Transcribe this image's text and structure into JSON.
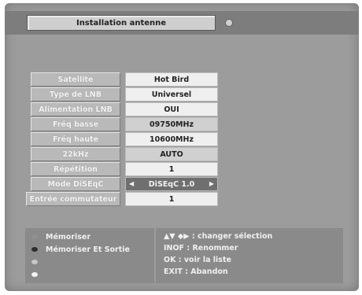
{
  "header": {
    "title": "Installation antenne"
  },
  "rows": [
    {
      "label": "Satellite",
      "value": "Hot Bird"
    },
    {
      "label": "Type de LNB",
      "value": "Universel"
    },
    {
      "label": "Alimentation LNB",
      "value": "OUI"
    },
    {
      "label": "Fréq basse",
      "value": "09750MHz"
    },
    {
      "label": "Fréq haute",
      "value": "10600MHz"
    },
    {
      "label": "22kHz",
      "value": "AUTO"
    },
    {
      "label": "Répétition",
      "value": "1"
    },
    {
      "label": "Mode DiSEqC",
      "value": "DiSEqC 1.0"
    },
    {
      "label": "Entrée commutateur",
      "value": "1"
    }
  ],
  "legend": {
    "actions": [
      {
        "label": "Mémoriser",
        "color": "#8f8f8f"
      },
      {
        "label": "Mémoriser  Et Sortie",
        "color": "#2d2d2d"
      },
      {
        "label": "",
        "color": "#c8c8c8"
      },
      {
        "label": "",
        "color": "#f4f4f4"
      }
    ],
    "help": [
      "▲▼ ◆▶ : changer sélection",
      "INOF : Renommer",
      "OK : voir la liste",
      "EXIT : Abandon"
    ]
  },
  "icons": {
    "title_indicator": "dot-icon",
    "left_arrow": "left-arrow-icon",
    "right_arrow": "right-arrow-icon"
  }
}
